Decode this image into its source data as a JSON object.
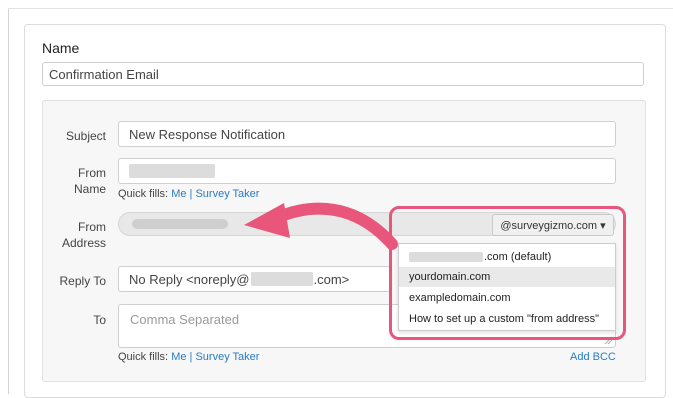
{
  "name_section": {
    "label": "Name",
    "value": "Confirmation Email"
  },
  "subject": {
    "label": "Subject",
    "value": "New Response Notification"
  },
  "from_name": {
    "label_line1": "From",
    "label_line2": "Name",
    "quick_fills_label": "Quick fills:",
    "quick_fill_me": "Me",
    "separator": "|",
    "quick_fill_survey_taker": "Survey Taker"
  },
  "from_address": {
    "label_line1": "From",
    "label_line2": "Address",
    "domain_button": "@surveygizmo.com ▾",
    "options": [
      {
        "label": ".com (default)"
      },
      {
        "label": "yourdomain.com"
      },
      {
        "label": "exampledomain.com"
      },
      {
        "label": "How to set up a custom \"from address\""
      }
    ]
  },
  "reply_to": {
    "label": "Reply To",
    "value_prefix": "No Reply <noreply@",
    "value_suffix": ".com>"
  },
  "to": {
    "label": "To",
    "placeholder": "Comma Separated",
    "quick_fills_label": "Quick fills:",
    "quick_fill_me": "Me",
    "separator": "|",
    "quick_fill_survey_taker": "Survey Taker",
    "add_bcc": "Add BCC"
  },
  "colors": {
    "highlight": "#e8577b",
    "link": "#2a7bc4"
  }
}
